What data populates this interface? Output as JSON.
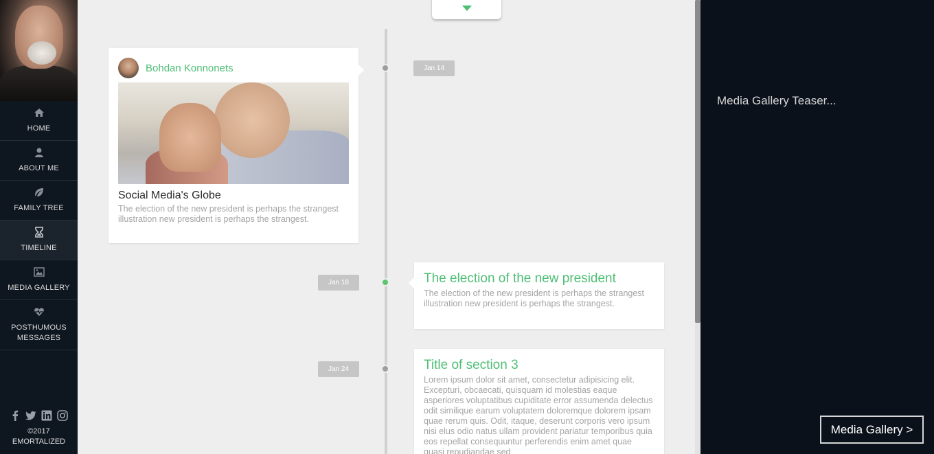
{
  "sidebar": {
    "items": [
      {
        "label": "HOME",
        "icon": "home-icon"
      },
      {
        "label": "ABOUT ME",
        "icon": "user-icon"
      },
      {
        "label": "FAMILY TREE",
        "icon": "leaf-icon"
      },
      {
        "label": "TIMELINE",
        "icon": "hourglass-icon",
        "active": true
      },
      {
        "label": "MEDIA GALLERY",
        "icon": "image-icon"
      },
      {
        "label": "POSTHUMOUS MESSAGES",
        "icon": "heartbeat-icon"
      }
    ],
    "social": [
      "facebook-icon",
      "twitter-icon",
      "linkedin-icon",
      "instagram-icon"
    ],
    "footer": {
      "year": "©2017",
      "brand": "EMORTALIZED"
    }
  },
  "timeline": {
    "entries": [
      {
        "date": "Jan 14",
        "author": "Bohdan Konnonets",
        "title": "Social Media's Globe",
        "text": "The election of the new president is perhaps the strangest illustration new president is perhaps the strangest."
      },
      {
        "date": "Jan 18",
        "title": "The election of the new president",
        "text": "The election of the new president is perhaps the strangest illustration new president is perhaps the strangest."
      },
      {
        "date": "Jan 24",
        "title": "Title of section 3",
        "text": "Lorem ipsum dolor sit amet, consectetur adipisicing elit. Excepturi, obcaecati, quisquam id molestias eaque asperiores voluptatibus cupiditate error assumenda delectus odit similique earum voluptatem doloremque dolorem ipsam quae rerum quis. Odit, itaque, deserunt corporis vero ipsum nisi elus odio natus ullam provident pariatur temporibus quia eos repellat consequuntur perferendis enim amet quae quasi repudiandae sed"
      }
    ]
  },
  "right_panel": {
    "teaser": "Media Gallery Teaser...",
    "button": "Media Gallery >"
  },
  "colors": {
    "accent": "#4fbf75",
    "sidebar": "#0e1620",
    "main_bg": "#eeeeee"
  }
}
